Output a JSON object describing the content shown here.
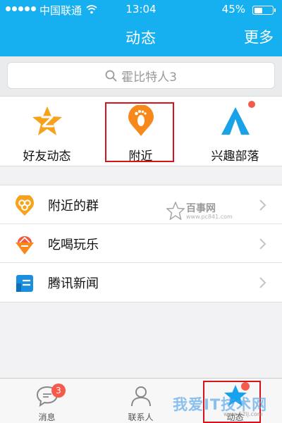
{
  "status_bar": {
    "carrier": "中国联通",
    "time": "13:04",
    "battery_percent": "45%",
    "battery_level": 0.45,
    "signal_icon": "signal-dots-icon",
    "wifi_icon": "wifi-icon"
  },
  "nav": {
    "title": "动态",
    "more_label": "更多"
  },
  "search": {
    "placeholder": "霍比特人3",
    "icon": "search-icon"
  },
  "tiles": [
    {
      "label": "好友动态",
      "icon": "qzone-star-icon"
    },
    {
      "label": "附近",
      "icon": "footprint-pin-icon"
    },
    {
      "label": "兴趣部落",
      "icon": "tent-icon"
    }
  ],
  "list": [
    {
      "label": "附近的群",
      "icon": "nearby-group-icon"
    },
    {
      "label": "吃喝玩乐",
      "icon": "food-fun-icon"
    },
    {
      "label": "腾讯新闻",
      "icon": "news-icon"
    }
  ],
  "tabs": [
    {
      "label": "消息",
      "badge": "3",
      "icon": "chat-bubble-icon"
    },
    {
      "label": "联系人",
      "icon": "contacts-icon"
    },
    {
      "label": "动态",
      "icon": "star-icon"
    }
  ],
  "watermarks": {
    "top_title": "百事网",
    "top_url": "www.pc841.com",
    "bottom_title": "我爱IT技术网",
    "bottom_url": "www.52ij.com"
  },
  "colors": {
    "accent": "#16b0f0",
    "badge": "#f55a4a",
    "highlight": "#d8131c",
    "orange": "#f7a21b"
  }
}
